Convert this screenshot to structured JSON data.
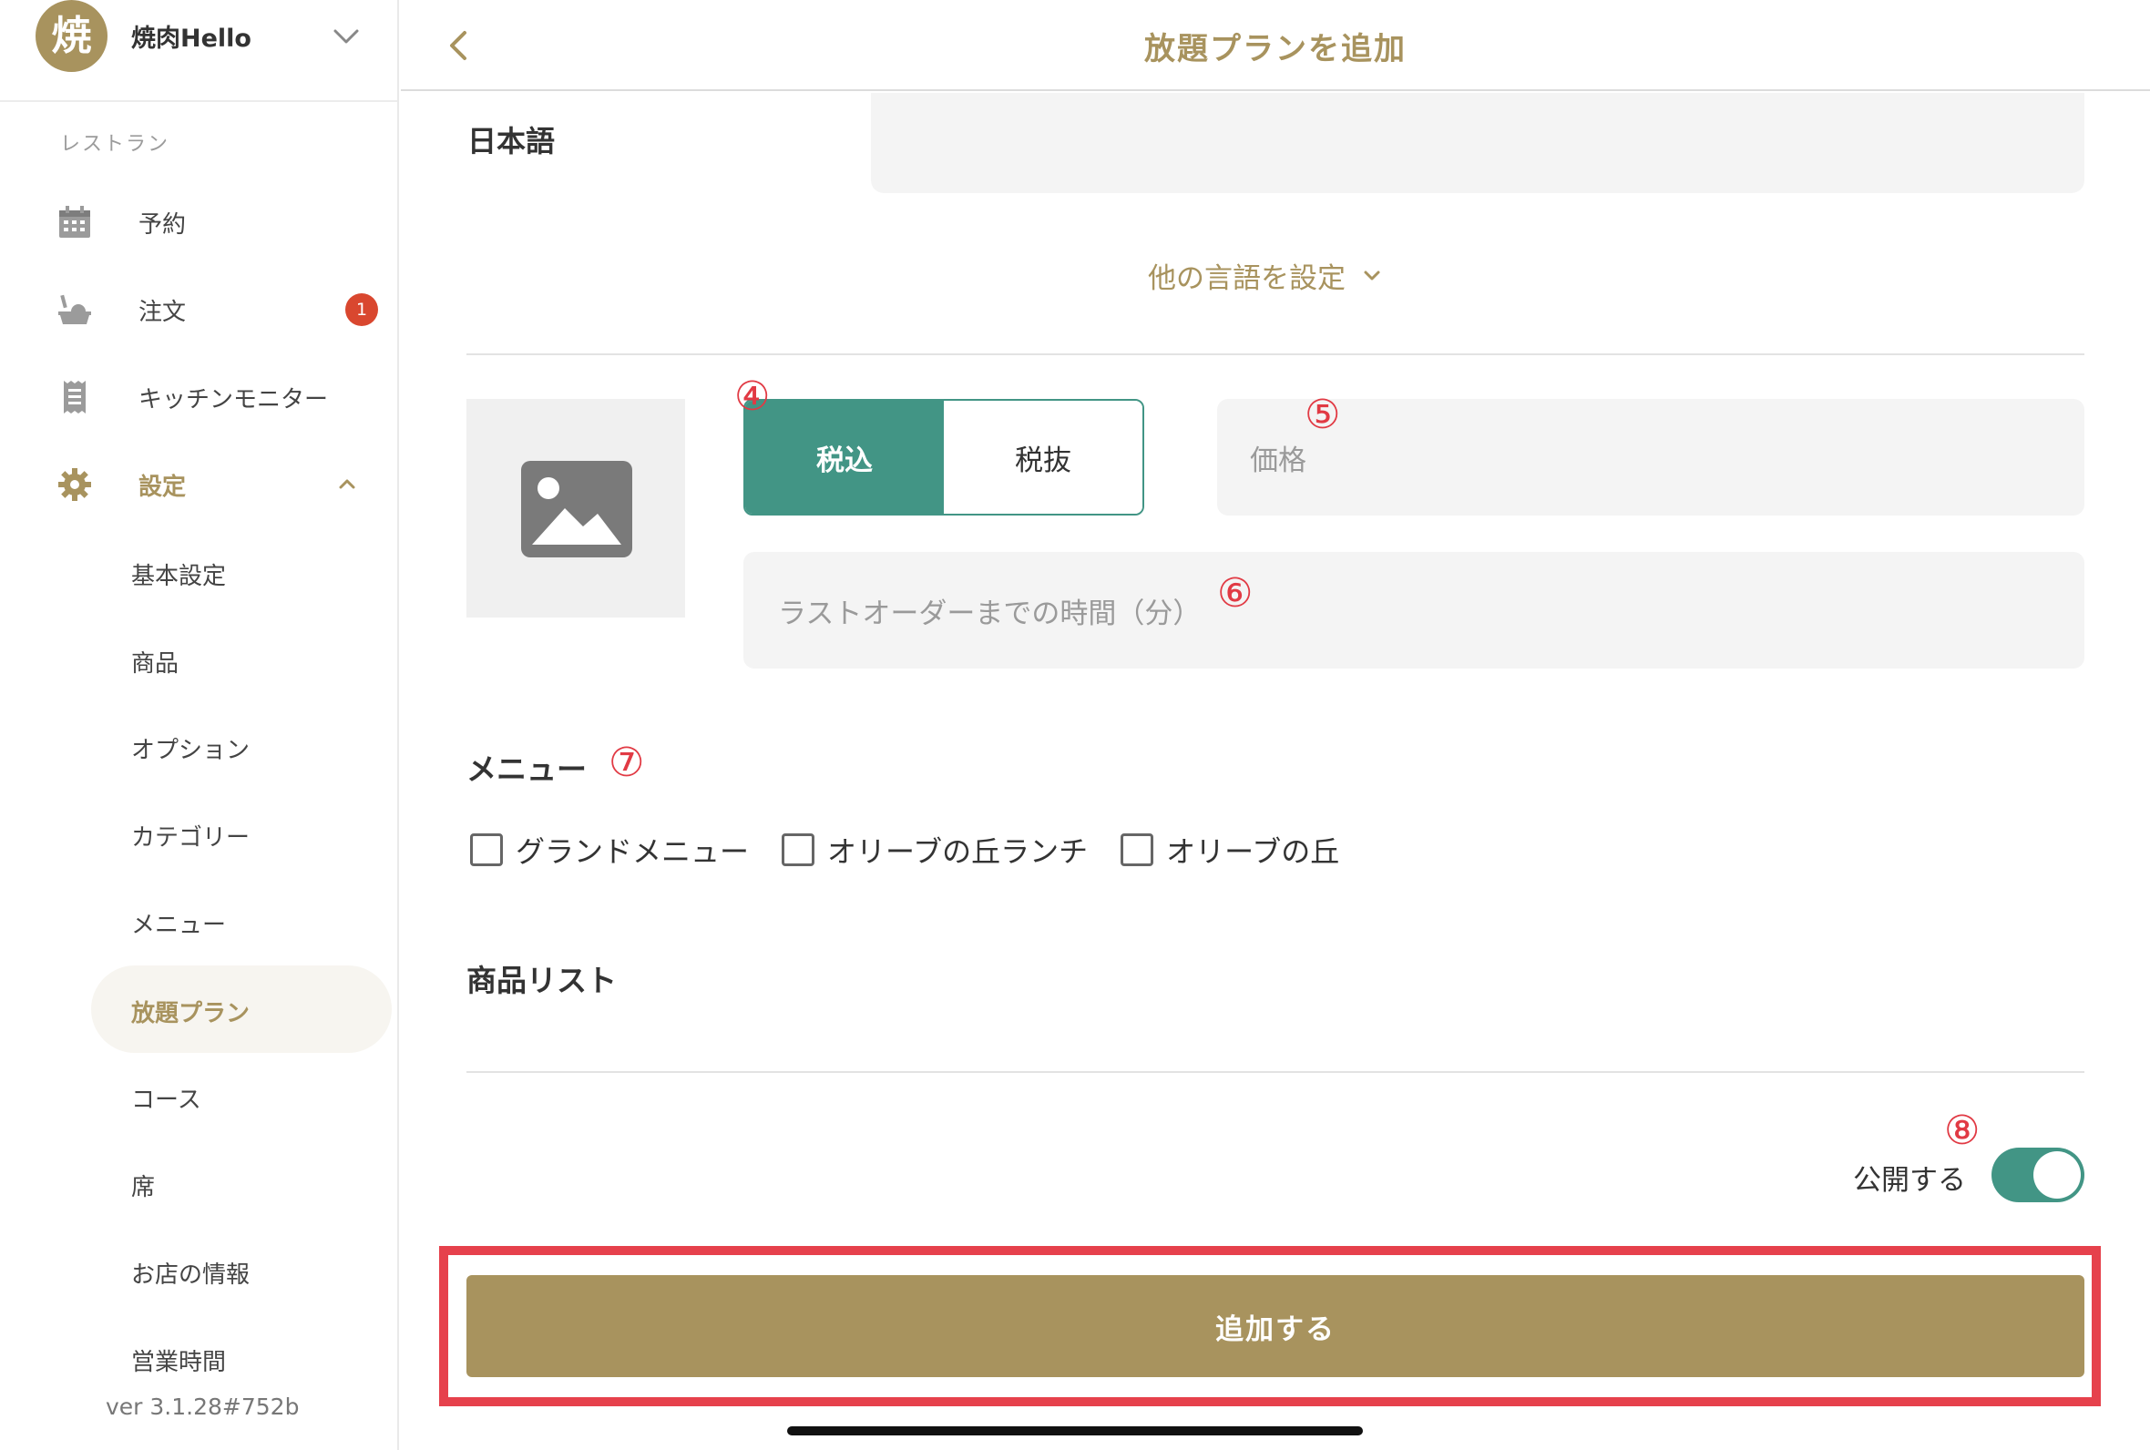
{
  "sidebar": {
    "shop": {
      "avatar_char": "焼",
      "name": "焼肉Hello"
    },
    "section_label": "レストラン",
    "nav": [
      {
        "label": "予約",
        "icon": "calendar-icon"
      },
      {
        "label": "注文",
        "icon": "order-tray-icon",
        "badge": "1"
      },
      {
        "label": "キッチンモニター",
        "icon": "receipt-icon"
      },
      {
        "label": "設定",
        "icon": "gear-icon"
      }
    ],
    "settings_items": [
      "基本設定",
      "商品",
      "オプション",
      "カテゴリー",
      "メニュー",
      "放題プラン",
      "コース",
      "席",
      "お店の情報",
      "営業時間"
    ],
    "selected_item": "放題プラン",
    "version": "ver 3.1.28#752b"
  },
  "topbar": {
    "title": "放題プランを追加"
  },
  "form": {
    "language_label": "日本語",
    "other_language_link": "他の言語を設定",
    "tax": {
      "included": "税込",
      "excluded": "税抜",
      "selected": "税込"
    },
    "price_placeholder": "価格",
    "last_order_placeholder": "ラストオーダーまでの時間（分）",
    "menu_label": "メニュー",
    "menus": [
      "グランドメニュー",
      "オリーブの丘ランチ",
      "オリーブの丘"
    ],
    "product_list_label": "商品リスト",
    "publish_label": "公開する",
    "publish_on": true,
    "submit_label": "追加する"
  },
  "annotations": [
    "④",
    "⑤",
    "⑥",
    "⑦",
    "⑧"
  ],
  "colors": {
    "brand_gold": "#a8935e",
    "teal": "#429585",
    "badge_red": "#d9472f",
    "annotation_red": "#e13a44"
  }
}
